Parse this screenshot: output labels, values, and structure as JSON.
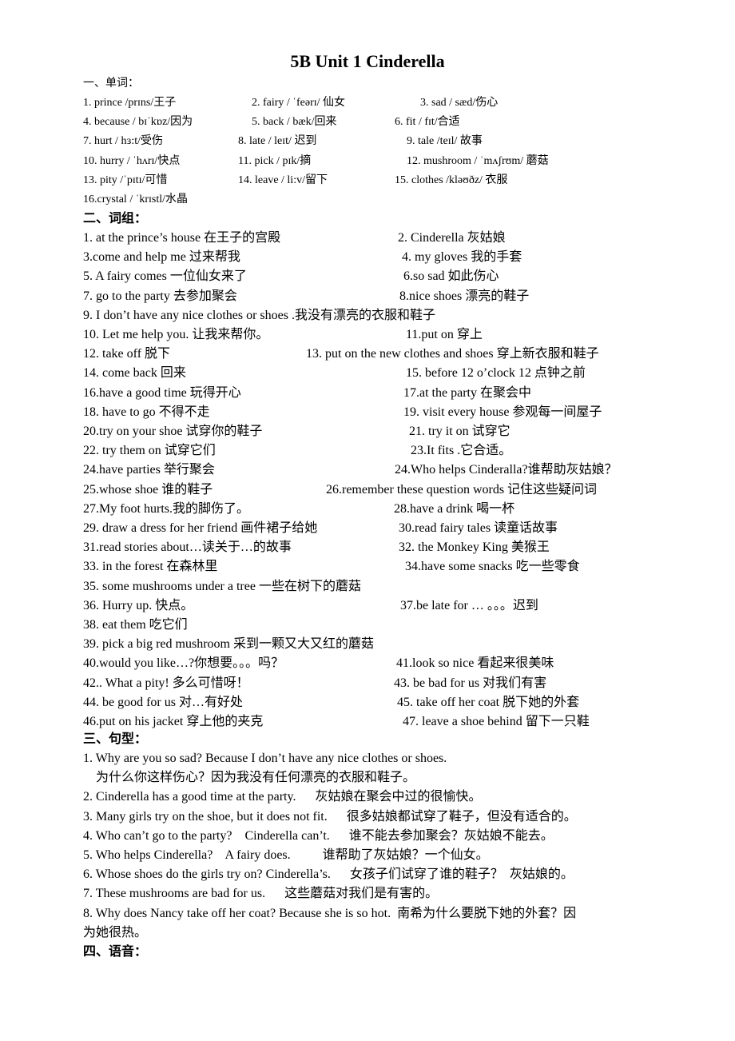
{
  "title": "5B Unit 1 Cinderella",
  "sections": {
    "words": {
      "heading": "一、单词：",
      "rows": [
        [
          "1. prince /prɪns/王子",
          "2. fairy / ˈfeərɪ/   仙女",
          "3. sad      / sæd/伤心"
        ],
        [
          "4. because / bɪˈkɒz/因为",
          "5. back     / bæk/回来",
          "6. fit / fɪt/合适"
        ],
        [
          "7. hurt     / hɜ:t/受伤",
          "8. late / leɪt/     迟到",
          "9. tale    /teɪl/       故事"
        ],
        [
          "10. hurry / ˈhʌrɪ/快点",
          "11. pick   / pɪk/摘",
          "12. mushroom / ˈmʌʃrʊm/  蘑菇"
        ],
        [
          "13. pity   /ˈpɪtɪ/可惜",
          "14. leave / li:v/留下",
          "15. clothes      /kləʊðz/  衣服"
        ],
        [
          "16.crystal    / ˈkrɪstl/水晶",
          "",
          ""
        ]
      ]
    },
    "phrases": {
      "heading": "二、词组：",
      "rows": [
        [
          "1. at the prince’s house         在王子的宫殿",
          "2. Cinderella 灰姑娘"
        ],
        [
          "3.come and help me    过来帮我",
          "4. my gloves  我的手套"
        ],
        [
          "5. A fairy comes  一位仙女来了",
          "6.so sad  如此伤心"
        ],
        [
          "7. go to the party          去参加聚会",
          "8.nice shoes  漂亮的鞋子"
        ],
        [
          "9. I don’t have any nice clothes or shoes .我没有漂亮的衣服和鞋子",
          ""
        ],
        [
          "10. Let me help you.          让我来帮你。",
          "11.put on 穿上"
        ],
        [
          "12. take off  脱下",
          "13. put on the new clothes and shoes  穿上新衣服和鞋子"
        ],
        [
          "14.  come back    回来",
          "15. before 12 o’clock    12 点钟之前"
        ],
        [
          "16.have a good time  玩得开心",
          "17.at the party  在聚会中"
        ],
        [
          "18. have to go  不得不走",
          "19. visit every house    参观每一间屋子"
        ],
        [
          "20.try on your shoe 试穿你的鞋子",
          "21. try it on  试穿它"
        ],
        [
          "22. try them on  试穿它们",
          "23.It fits .它合适。"
        ],
        [
          "24.have parties        举行聚会",
          "24.Who helps Cinderalla?谁帮助灰姑娘？"
        ],
        [
          "25.whose shoe  谁的鞋子",
          "26.remember these question words    记住这些疑问词"
        ],
        [
          "27.My foot hurts.我的脚伤了。",
          "28.have a drink  喝一杯"
        ],
        [
          "29.  draw a dress for her friend 画件裙子给她",
          "30.read fairy tales 读童话故事"
        ],
        [
          "31.read stories about…读关于…的故事",
          "32. the Monkey King  美猴王"
        ],
        [
          "33. in the forest 在森林里",
          "34.have some snacks    吃一些零食"
        ],
        [
          "35.    some mushrooms under a tree  一些在树下的蘑菇",
          ""
        ],
        [
          "36. Hurry up.    快点。",
          "37.be late for …    。。。迟到"
        ],
        [
          "38. eat them  吃它们",
          ""
        ],
        [
          "39. pick a big red mushroom 采到一颗又大又红的蘑菇",
          ""
        ],
        [
          "40.would you like…?你想要。。。吗？",
          "41.look so nice    看起来很美味"
        ],
        [
          "42.. What a pity!    多么可惜呀！",
          "43. be bad for us      对我们有害"
        ],
        [
          "44. be good for us      对…有好处",
          "45. take off her coat    脱下她的外套"
        ],
        [
          "46.put on his jacket 穿上他的夹克",
          "47. leave a shoe behind    留下一只鞋"
        ]
      ]
    },
    "sentences": {
      "heading": "三、句型：",
      "lines": [
        "1. Why are you so sad? Because I don’t have any nice clothes or shoes.",
        "    为什么你这样伤心？因为我没有任何漂亮的衣服和鞋子。",
        "2. Cinderella has a good time at the party.      灰姑娘在聚会中过的很愉快。",
        "3. Many girls try on the shoe, but it does not fit.      很多姑娘都试穿了鞋子，但没有适合的。",
        "4. Who can’t go to the party?    Cinderella can’t.      谁不能去参加聚会？灰姑娘不能去。",
        "5. Who helps Cinderella?    A fairy does.          谁帮助了灰姑娘？一个仙女。",
        "6. Whose shoes do the girls try on? Cinderella’s.      女孩子们试穿了谁的鞋子？  灰姑娘的。",
        "7. These mushrooms are bad for us.      这些蘑菇对我们是有害的。",
        "8. Why does Nancy take off her coat? Because she is so hot.  南希为什么要脱下她的外套？因",
        "为她很热。"
      ]
    },
    "phonics": {
      "heading": "四、语音："
    }
  }
}
